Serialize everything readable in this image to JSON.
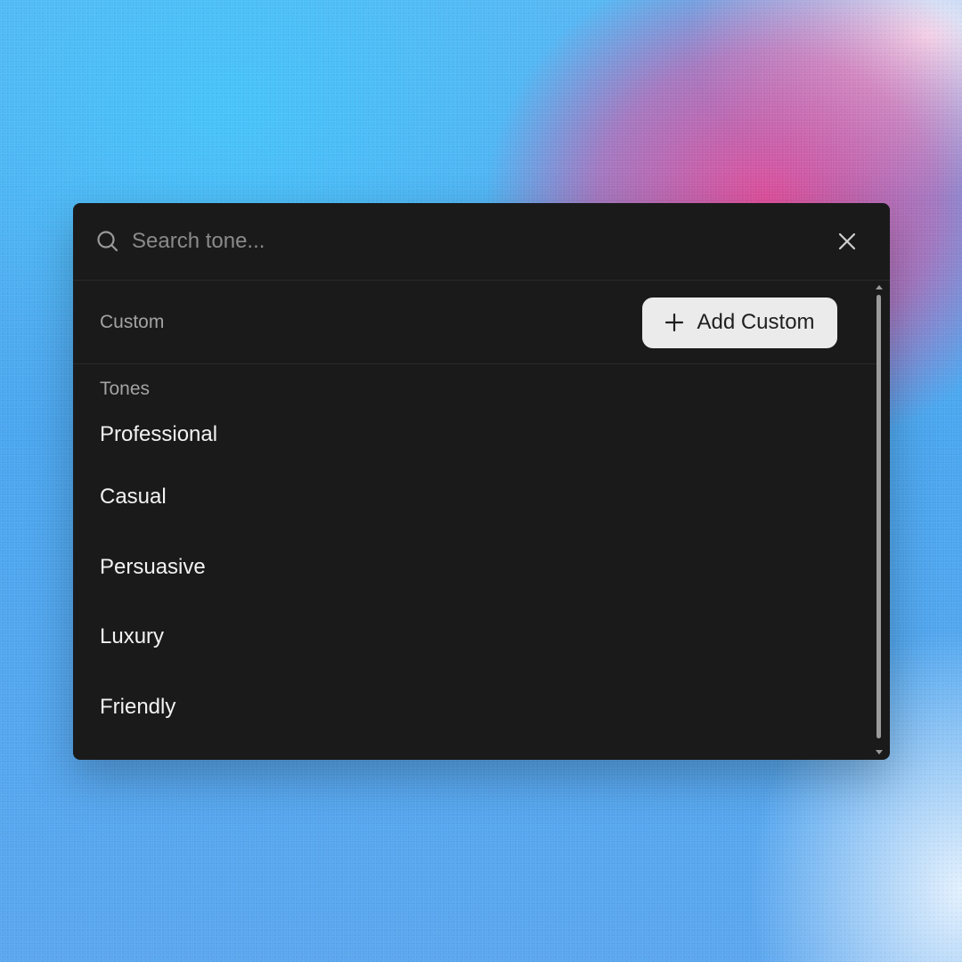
{
  "search": {
    "placeholder": "Search tone...",
    "value": ""
  },
  "custom_section": {
    "label": "Custom",
    "add_button_label": "Add Custom"
  },
  "tones_section": {
    "label": "Tones",
    "items": [
      {
        "label": "Professional"
      },
      {
        "label": "Casual"
      },
      {
        "label": "Persuasive"
      },
      {
        "label": "Luxury"
      },
      {
        "label": "Friendly"
      }
    ]
  },
  "icons": {
    "search": "search-icon",
    "close": "close-icon",
    "add": "plus-icon"
  },
  "colors": {
    "panel_background": "#1a1a1b",
    "button_background": "#ebebeb",
    "text_primary": "#f2f2f2",
    "text_muted": "#a3a3a3"
  }
}
